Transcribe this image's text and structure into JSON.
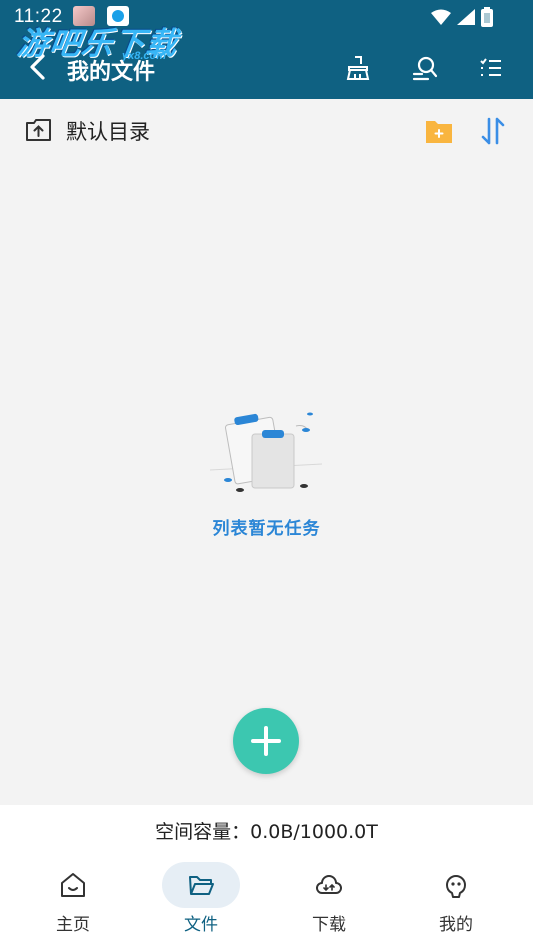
{
  "status_bar": {
    "time": "11:22"
  },
  "watermark": {
    "text": "游吧乐下载",
    "sub": "yx8.com"
  },
  "app_bar": {
    "title": "我的文件",
    "icons": [
      "back-arrow-icon",
      "broom-clean-icon",
      "search-user-icon",
      "checklist-icon"
    ]
  },
  "directory": {
    "label": "默认目录",
    "icons": [
      "folder-up-icon",
      "new-folder-icon",
      "sort-icon"
    ]
  },
  "empty_state": {
    "message": "列表暂无任务"
  },
  "storage": {
    "capacity_text": "空间容量：0.0B/1000.0T"
  },
  "bottom_nav": {
    "items": [
      {
        "label": "主页",
        "icon": "home-icon"
      },
      {
        "label": "文件",
        "icon": "folder-icon"
      },
      {
        "label": "下载",
        "icon": "cloud-download-icon"
      },
      {
        "label": "我的",
        "icon": "profile-icon"
      }
    ],
    "active_index": 1
  },
  "colors": {
    "header": "#0f6182",
    "accent": "#3cc7b0",
    "empty_text": "#2b86d6",
    "folder": "#f9b53f",
    "sort": "#3a8ee6"
  }
}
